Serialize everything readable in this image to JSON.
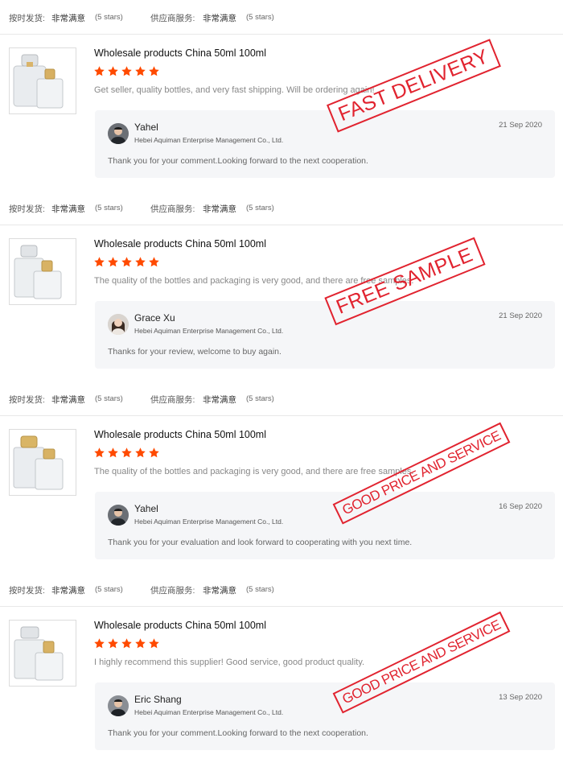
{
  "stamp_color": "#e1232f",
  "star_color": "#ff4a00",
  "reviews": [
    {
      "rating": {
        "delivery_label": "按时发货:",
        "delivery_value": "非常满意",
        "delivery_stars": "(5 stars)",
        "service_label": "供应商服务:",
        "service_value": "非常满意",
        "service_stars": "(5 stars)"
      },
      "product_title": "Wholesale products China 50ml 100ml",
      "stars": 5,
      "comment": "Get seller, quality bottles, and very fast shipping. Will be ordering again!",
      "reply": {
        "name": "Yahel",
        "company": "Hebei Aquiman Enterprise Management Co., Ltd.",
        "date": "21 Sep 2020",
        "text": "Thank you for your comment.Looking forward to the next cooperation.",
        "avatar": "man-avatar"
      },
      "stamp": "FAST DELIVERY"
    },
    {
      "rating": {
        "delivery_label": "按时发货:",
        "delivery_value": "非常满意",
        "delivery_stars": "(5 stars)",
        "service_label": "供应商服务:",
        "service_value": "非常满意",
        "service_stars": "(5 stars)"
      },
      "product_title": "Wholesale products China 50ml 100ml",
      "stars": 5,
      "comment": "The quality of the bottles and packaging is very good, and there are free samples.",
      "reply": {
        "name": "Grace Xu",
        "company": "Hebei Aquiman Enterprise Management Co., Ltd.",
        "date": "21 Sep 2020",
        "text": "Thanks for your review, welcome to buy again.",
        "avatar": "woman-avatar"
      },
      "stamp": "FREE SAMPLE"
    },
    {
      "rating": {
        "delivery_label": "按时发货:",
        "delivery_value": "非常满意",
        "delivery_stars": "(5 stars)",
        "service_label": "供应商服务:",
        "service_value": "非常满意",
        "service_stars": "(5 stars)"
      },
      "product_title": "Wholesale products China 50ml 100ml",
      "stars": 5,
      "comment": "The quality of the bottles and packaging is very good, and there are free samples.",
      "reply": {
        "name": "Yahel",
        "company": "Hebei Aquiman Enterprise Management Co., Ltd.",
        "date": "16 Sep 2020",
        "text": "Thank you for your evaluation and look forward to cooperating with you next time.",
        "avatar": "man-avatar"
      },
      "stamp": "GOOD PRICE AND SERVICE"
    },
    {
      "rating": {
        "delivery_label": "按时发货:",
        "delivery_value": "非常满意",
        "delivery_stars": "(5 stars)",
        "service_label": "供应商服务:",
        "service_value": "非常满意",
        "service_stars": "(5 stars)"
      },
      "product_title": "Wholesale products China 50ml 100ml",
      "stars": 5,
      "comment": "I highly recommend this supplier! Good service, good product quality.",
      "reply": {
        "name": "Eric Shang",
        "company": "Hebei Aquiman Enterprise Management Co., Ltd.",
        "date": "13 Sep 2020",
        "text": "Thank you for your comment.Looking forward to the next cooperation.",
        "avatar": "man-avatar"
      },
      "stamp": "GOOD PRICE AND SERVICE"
    }
  ]
}
